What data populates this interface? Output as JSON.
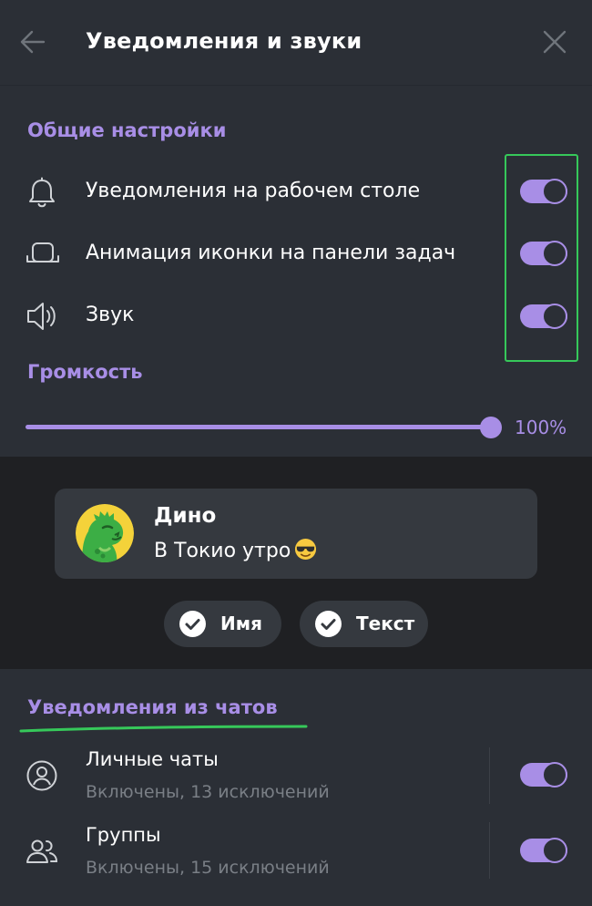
{
  "header": {
    "title": "Уведомления и звуки",
    "back_icon": "arrow-left-icon",
    "close_icon": "close-icon"
  },
  "general": {
    "title": "Общие настройки",
    "items": [
      {
        "label": "Уведомления на рабочем столе",
        "icon": "bell-icon",
        "enabled": true
      },
      {
        "label": "Анимация иконки на панели задач",
        "icon": "taskbar-icon",
        "enabled": true
      },
      {
        "label": "Звук",
        "icon": "speaker-icon",
        "enabled": true
      }
    ]
  },
  "volume": {
    "title": "Громкость",
    "value_label": "100%",
    "level": 1.0
  },
  "preview": {
    "sender": "Дино",
    "message": "В Токио утро",
    "emoji": "sunglasses-emoji",
    "chips": [
      {
        "label": "Имя",
        "checked": true
      },
      {
        "label": "Текст",
        "checked": true
      }
    ]
  },
  "chats": {
    "title": "Уведомления из чатов",
    "items": [
      {
        "title": "Личные чаты",
        "subtitle": "Включены, 13 исключений",
        "icon": "user-circle-icon",
        "enabled": true
      },
      {
        "title": "Группы",
        "subtitle": "Включены, 15 исключений",
        "icon": "users-icon",
        "enabled": true
      }
    ]
  },
  "colors": {
    "accent": "#a88ee6",
    "background": "#2b2f36",
    "preview_background": "#1f2023",
    "card": "#35393f",
    "highlight_green": "#36c85a",
    "muted_text": "#7a7f86"
  }
}
